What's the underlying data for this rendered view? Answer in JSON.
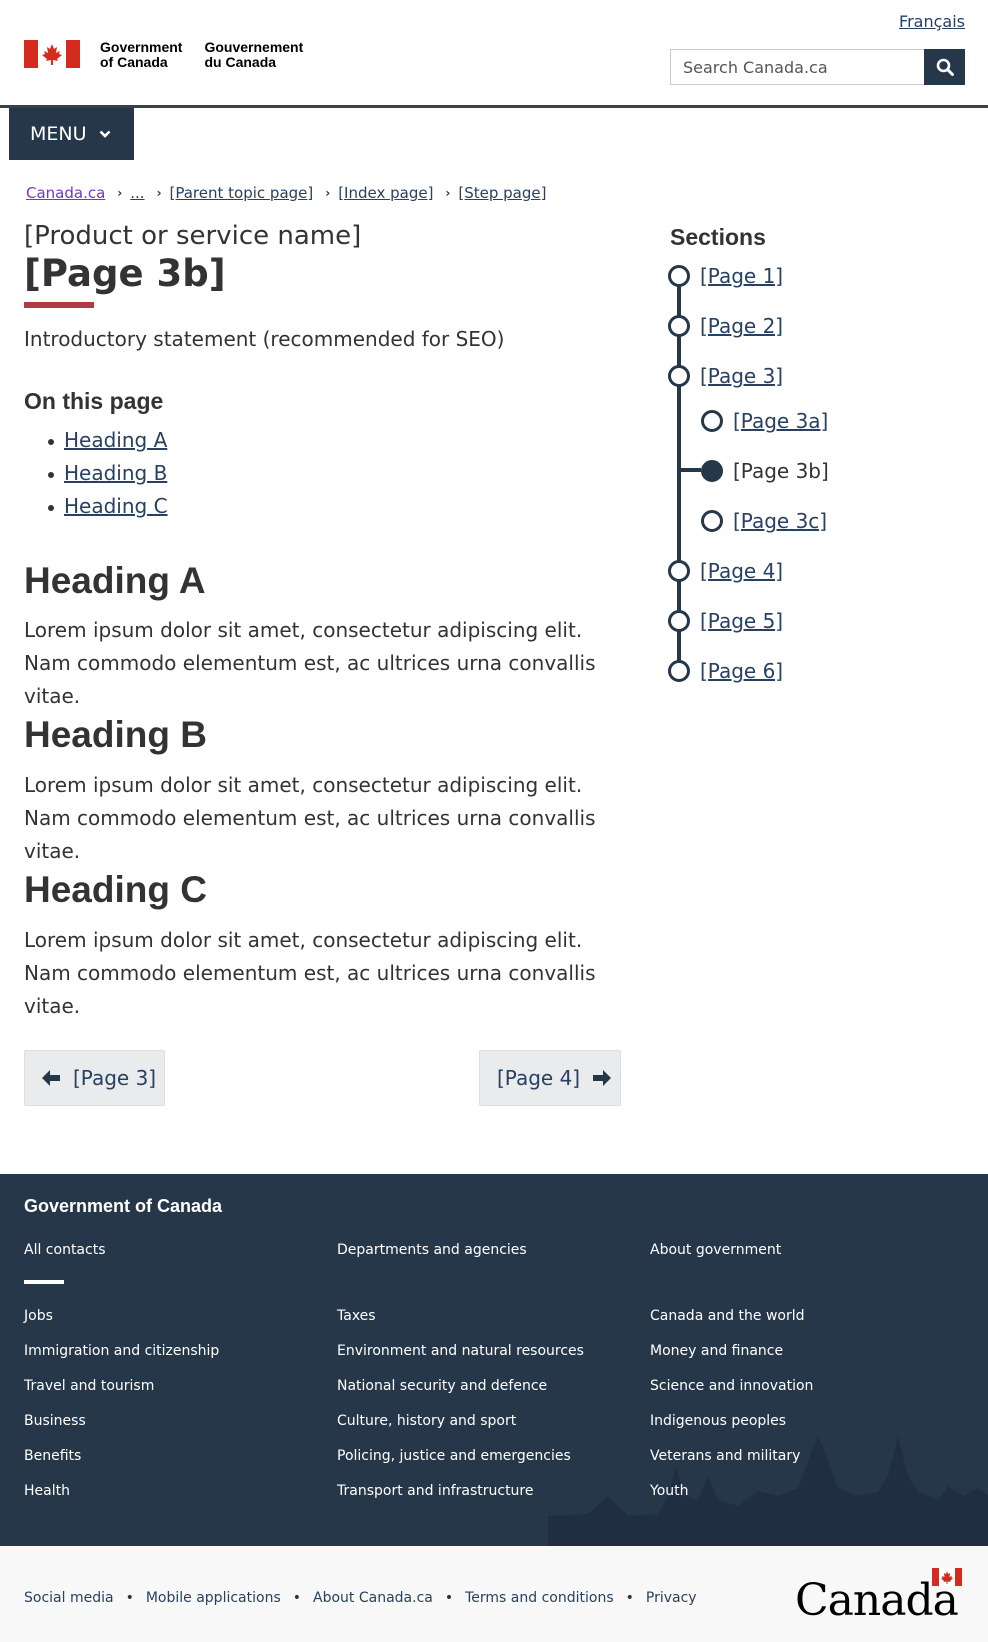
{
  "header": {
    "lang_link": "Français",
    "signature_en": [
      "Government",
      "of Canada"
    ],
    "signature_fr": [
      "Gouvernement",
      "du Canada"
    ],
    "search_placeholder": "Search Canada.ca",
    "menu_label": "MENU",
    "brand_red": "#d52b1e",
    "dark_blue": "#26374a"
  },
  "breadcrumb": [
    "Canada.ca",
    "...",
    "[Parent topic page]",
    "[Index page]",
    "[Step page]"
  ],
  "main": {
    "product_name": "[Product or service name]",
    "page_title": "[Page 3b]",
    "intro": "Introductory statement (recommended for SEO)",
    "on_this_page": {
      "heading": "On this page",
      "links": [
        "Heading A",
        "Heading B",
        "Heading C"
      ]
    },
    "sections": [
      {
        "heading": "Heading A",
        "body": "Lorem ipsum dolor sit amet, consectetur adipiscing elit. Nam commodo elementum est, ac ultrices urna convallis vitae."
      },
      {
        "heading": "Heading B",
        "body": "Lorem ipsum dolor sit amet, consectetur adipiscing elit. Nam commodo elementum est, ac ultrices urna convallis vitae."
      },
      {
        "heading": "Heading C",
        "body": "Lorem ipsum dolor sit amet, consectetur adipiscing elit. Nam commodo elementum est, ac ultrices urna convallis vitae."
      }
    ],
    "pager": {
      "prev": "[Page 3]",
      "next": "[Page 4]"
    }
  },
  "sections_nav": {
    "title": "Sections",
    "items": [
      {
        "label": "[Page 1]"
      },
      {
        "label": "[Page 2]"
      },
      {
        "label": "[Page 3]"
      },
      {
        "label": "[Page 3a]"
      },
      {
        "label": "[Page 3b]",
        "current": true
      },
      {
        "label": "[Page 3c]"
      },
      {
        "label": "[Page 4]"
      },
      {
        "label": "[Page 5]"
      },
      {
        "label": "[Page 6]"
      }
    ]
  },
  "footer": {
    "title": "Government of Canada",
    "top_links": [
      "All contacts",
      "Departments and agencies",
      "About government"
    ],
    "col1": [
      "Jobs",
      "Immigration and citizenship",
      "Travel and tourism",
      "Business",
      "Benefits",
      "Health"
    ],
    "col2": [
      "Taxes",
      "Environment and natural resources",
      "National security and defence",
      "Culture, history and sport",
      "Policing, justice and emergencies",
      "Transport and infrastructure"
    ],
    "col3": [
      "Canada and the world",
      "Money and finance",
      "Science and innovation",
      "Indigenous peoples",
      "Veterans and military",
      "Youth"
    ],
    "bottom_links": [
      "Social media",
      "Mobile applications",
      "About Canada.ca",
      "Terms and conditions",
      "Privacy"
    ],
    "wordmark": "Canada"
  }
}
